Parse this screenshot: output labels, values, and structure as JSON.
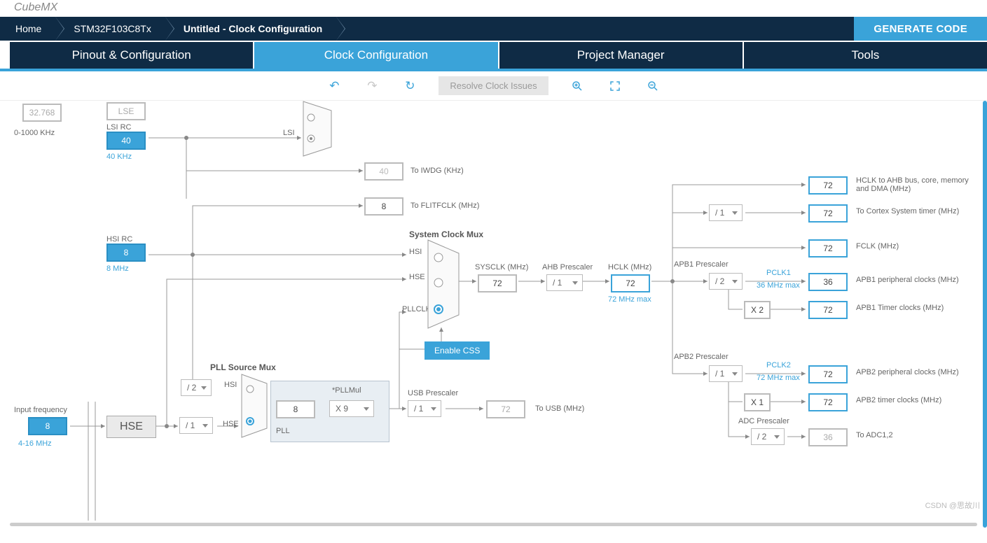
{
  "logo": {
    "t1": "Cube",
    "t2": "MX"
  },
  "breadcrumb": {
    "home": "Home",
    "chip": "STM32F103C8Tx",
    "current": "Untitled - Clock Configuration"
  },
  "generate": "GENERATE CODE",
  "tabs": {
    "pinout": "Pinout & Configuration",
    "clock": "Clock Configuration",
    "project": "Project Manager",
    "tools": "Tools"
  },
  "toolbar": {
    "resolve": "Resolve Clock Issues"
  },
  "sources": {
    "lsi_rc_title": "LSI RC",
    "lsi_val": "40",
    "lsi_sub": "40 KHz",
    "lsi_lbl": "LSI",
    "lse_title": "LSE",
    "hsi_rc_title": "HSI RC",
    "hsi_val": "8",
    "hsi_sub": "8 MHz",
    "hse_title": "HSE",
    "infreq_lbl": "Input frequency",
    "infreq_val": "8",
    "infreq_sub": "4-16 MHz",
    "range_khz": "0-1000 KHz"
  },
  "iwdg": {
    "val": "40",
    "lbl": "To IWDG (KHz)"
  },
  "flit": {
    "val": "8",
    "lbl": "To FLITFCLK (MHz)"
  },
  "sysmux": {
    "title": "System Clock Mux",
    "hsi": "HSI",
    "hse": "HSE",
    "pllclk": "PLLCLK"
  },
  "sysclk": {
    "lbl": "SYSCLK (MHz)",
    "val": "72"
  },
  "ahb": {
    "lbl": "AHB Prescaler",
    "sel": "/ 1"
  },
  "hclk": {
    "lbl": "HCLK (MHz)",
    "val": "72",
    "max": "72 MHz max"
  },
  "css": "Enable CSS",
  "pllmux": {
    "title": "PLL Source Mux",
    "hsi": "HSI",
    "hse": "HSE",
    "div2": "/ 2"
  },
  "pll": {
    "lbl": "PLL",
    "val": "8",
    "mul_title": "*PLLMul",
    "mul": "X 9"
  },
  "hse_sel": "/ 1",
  "usb": {
    "title": "USB Prescaler",
    "sel": "/ 1",
    "val": "72",
    "lbl": "To USB (MHz)"
  },
  "outputs": {
    "hclk_ahb": "HCLK to AHB bus, core, memory and DMA (MHz)",
    "cortex_sel": "/ 1",
    "cortex_lbl": "To Cortex System timer (MHz)",
    "fclk_lbl": "FCLK (MHz)",
    "apb1_title": "APB1 Prescaler",
    "apb1_sel": "/ 2",
    "pclk1": "PCLK1",
    "pclk1_max": "36 MHz max",
    "apb1_peri_lbl": "APB1 peripheral clocks (MHz)",
    "apb1_peri_val": "36",
    "apb1_tim_mul": "X 2",
    "apb1_tim_lbl": "APB1 Timer clocks (MHz)",
    "apb1_tim_val": "72",
    "apb2_title": "APB2 Prescaler",
    "apb2_sel": "/ 1",
    "pclk2": "PCLK2",
    "pclk2_max": "72 MHz max",
    "apb2_peri_lbl": "APB2 peripheral clocks (MHz)",
    "apb2_peri_val": "72",
    "apb2_tim_mul": "X 1",
    "apb2_tim_lbl": "APB2 timer clocks (MHz)",
    "apb2_tim_val": "72",
    "adc_title": "ADC Prescaler",
    "adc_sel": "/ 2",
    "adc_val": "36",
    "adc_lbl": "To ADC1,2",
    "v72": "72"
  },
  "watermark": "CSDN @思故川"
}
